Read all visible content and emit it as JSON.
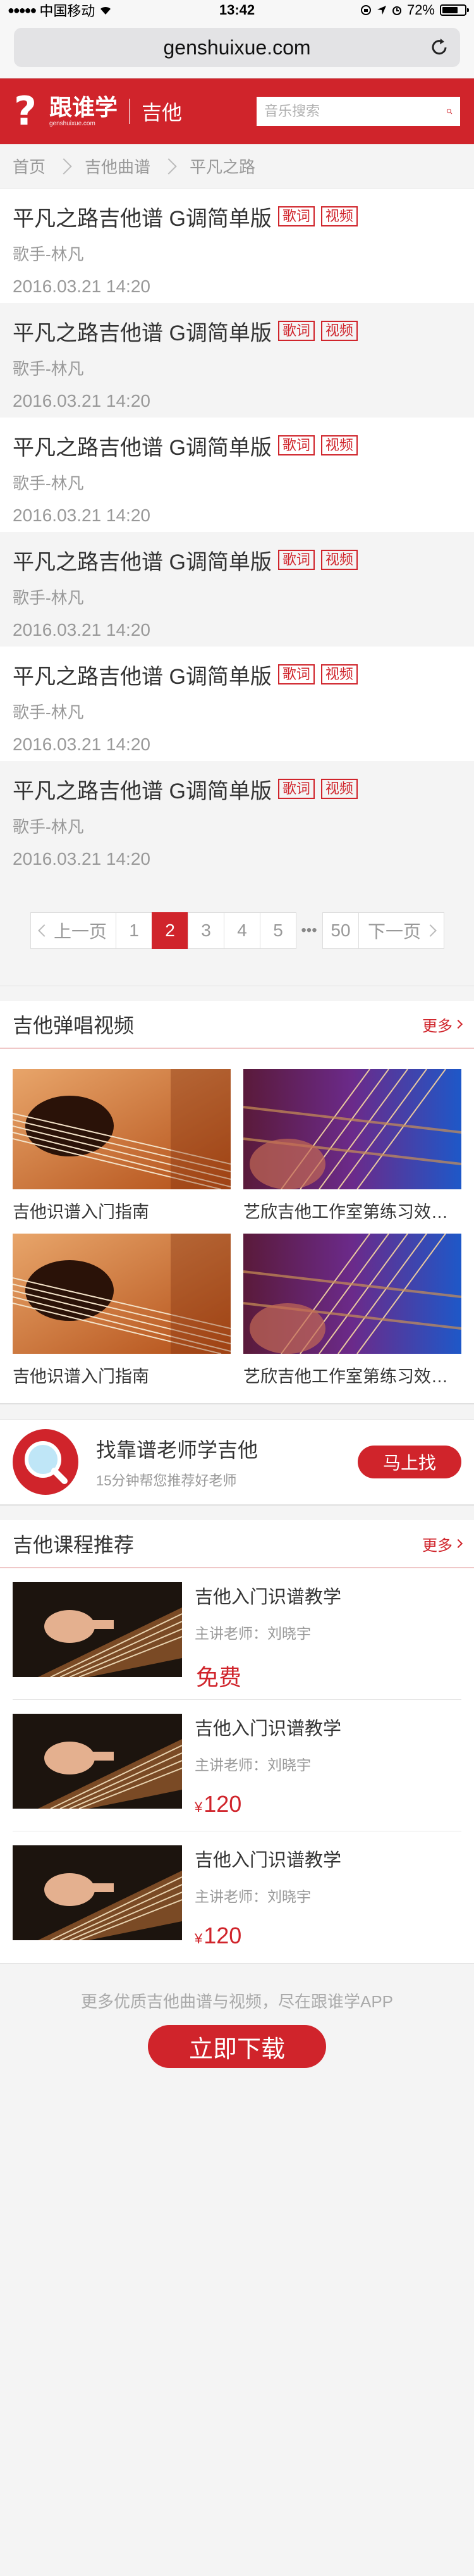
{
  "status_bar": {
    "carrier": "中国移动",
    "time": "13:42",
    "battery": "72%",
    "battery_level": 0.72
  },
  "browser": {
    "url": "genshuixue.com"
  },
  "header": {
    "logo_text": "跟谁学",
    "logo_sub": "genshuixue.com",
    "section": "吉他",
    "search_placeholder": "音乐搜索"
  },
  "breadcrumb": [
    "首页",
    "吉他曲谱",
    "平凡之路"
  ],
  "songs": [
    {
      "title": "平凡之路吉他谱 G调简单版",
      "tag1": "歌词",
      "tag2": "视频",
      "singer": "歌手-林凡",
      "date": "2016.03.21  14:20"
    },
    {
      "title": "平凡之路吉他谱 G调简单版",
      "tag1": "歌词",
      "tag2": "视频",
      "singer": "歌手-林凡",
      "date": "2016.03.21  14:20"
    },
    {
      "title": "平凡之路吉他谱 G调简单版",
      "tag1": "歌词",
      "tag2": "视频",
      "singer": "歌手-林凡",
      "date": "2016.03.21  14:20"
    },
    {
      "title": "平凡之路吉他谱 G调简单版",
      "tag1": "歌词",
      "tag2": "视频",
      "singer": "歌手-林凡",
      "date": "2016.03.21  14:20"
    },
    {
      "title": "平凡之路吉他谱 G调简单版",
      "tag1": "歌词",
      "tag2": "视频",
      "singer": "歌手-林凡",
      "date": "2016.03.21  14:20"
    },
    {
      "title": "平凡之路吉他谱 G调简单版",
      "tag1": "歌词",
      "tag2": "视频",
      "singer": "歌手-林凡",
      "date": "2016.03.21  14:20"
    }
  ],
  "pagination": {
    "prev": "上一页",
    "next": "下一页",
    "pages": [
      "1",
      "2",
      "3",
      "4",
      "5"
    ],
    "current": "2",
    "ellipsis": "•••",
    "last": "50"
  },
  "video_section": {
    "title": "吉他弹唱视频",
    "more": "更多",
    "items": [
      {
        "caption": "吉他识谱入门指南",
        "thumb": "guitar-warm"
      },
      {
        "caption": "艺欣吉他工作室第练习效果展示",
        "thumb": "guitar-blue"
      },
      {
        "caption": "吉他识谱入门指南",
        "thumb": "guitar-warm"
      },
      {
        "caption": "艺欣吉他工作室第练习效果展示",
        "thumb": "guitar-blue"
      }
    ]
  },
  "teacher_banner": {
    "title": "找靠谱老师学吉他",
    "subtitle": "15分钟帮您推荐好老师",
    "button": "马上找"
  },
  "course_section": {
    "title": "吉他课程推荐",
    "more": "更多",
    "items": [
      {
        "name": "吉他入门识谱教学",
        "teacher": "主讲老师：刘晓宇",
        "price": "免费",
        "currency": ""
      },
      {
        "name": "吉他入门识谱教学",
        "teacher": "主讲老师：刘晓宇",
        "price": "120",
        "currency": "¥"
      },
      {
        "name": "吉他入门识谱教学",
        "teacher": "主讲老师：刘晓宇",
        "price": "120",
        "currency": "¥"
      }
    ]
  },
  "footer": {
    "text": "更多优质吉他曲谱与视频，尽在跟谁学APP",
    "download": "立即下载"
  },
  "colors": {
    "brand": "#d0242b",
    "background": "#f4f4f4"
  }
}
